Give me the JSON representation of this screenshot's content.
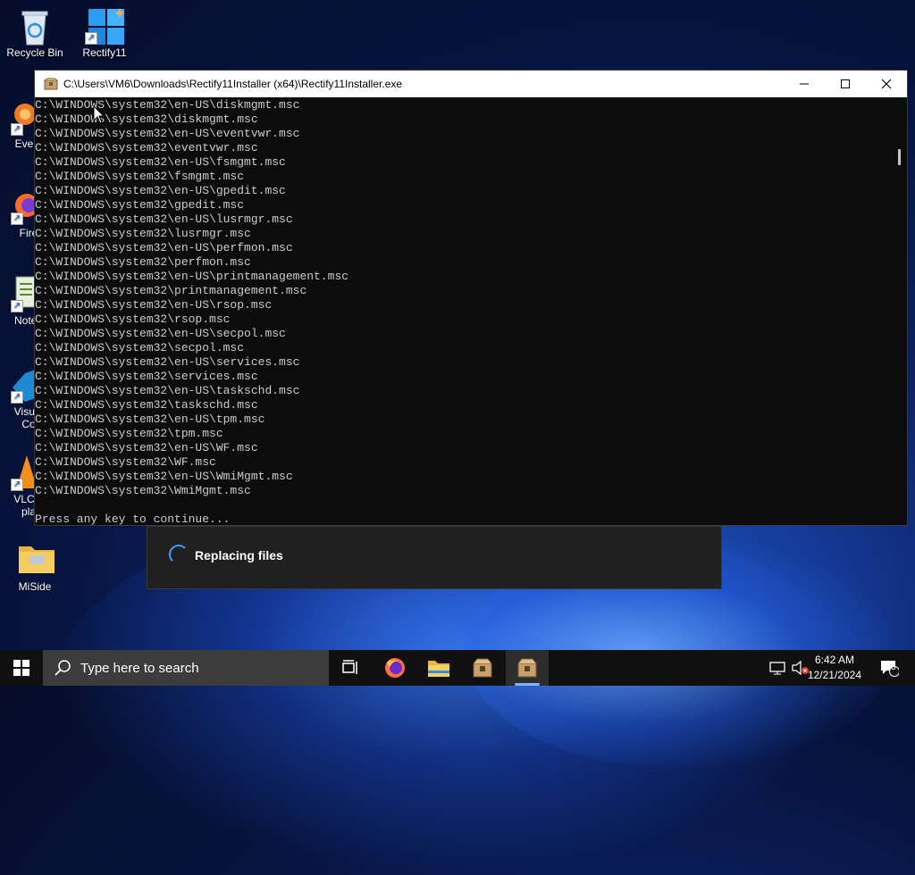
{
  "desktop": {
    "icons": [
      {
        "label": "Recycle Bin"
      },
      {
        "label": "Rectify11"
      },
      {
        "label": "Every"
      },
      {
        "label": "Fire"
      },
      {
        "label": "Notep"
      },
      {
        "label": "Visual"
      },
      {
        "label": "Co"
      },
      {
        "label": "VLC n"
      },
      {
        "label": "pla"
      },
      {
        "label": "MiSide"
      }
    ]
  },
  "console": {
    "title": "C:\\Users\\VM6\\Downloads\\Rectify11Installer (x64)\\Rectify11Installer.exe",
    "lines": [
      "C:\\WINDOWS\\system32\\en-US\\diskmgmt.msc",
      "C:\\WINDOWS\\system32\\diskmgmt.msc",
      "C:\\WINDOWS\\system32\\en-US\\eventvwr.msc",
      "C:\\WINDOWS\\system32\\eventvwr.msc",
      "C:\\WINDOWS\\system32\\en-US\\fsmgmt.msc",
      "C:\\WINDOWS\\system32\\fsmgmt.msc",
      "C:\\WINDOWS\\system32\\en-US\\gpedit.msc",
      "C:\\WINDOWS\\system32\\gpedit.msc",
      "C:\\WINDOWS\\system32\\en-US\\lusrmgr.msc",
      "C:\\WINDOWS\\system32\\lusrmgr.msc",
      "C:\\WINDOWS\\system32\\en-US\\perfmon.msc",
      "C:\\WINDOWS\\system32\\perfmon.msc",
      "C:\\WINDOWS\\system32\\en-US\\printmanagement.msc",
      "C:\\WINDOWS\\system32\\printmanagement.msc",
      "C:\\WINDOWS\\system32\\en-US\\rsop.msc",
      "C:\\WINDOWS\\system32\\rsop.msc",
      "C:\\WINDOWS\\system32\\en-US\\secpol.msc",
      "C:\\WINDOWS\\system32\\secpol.msc",
      "C:\\WINDOWS\\system32\\en-US\\services.msc",
      "C:\\WINDOWS\\system32\\services.msc",
      "C:\\WINDOWS\\system32\\en-US\\taskschd.msc",
      "C:\\WINDOWS\\system32\\taskschd.msc",
      "C:\\WINDOWS\\system32\\en-US\\tpm.msc",
      "C:\\WINDOWS\\system32\\tpm.msc",
      "C:\\WINDOWS\\system32\\en-US\\WF.msc",
      "C:\\WINDOWS\\system32\\WF.msc",
      "C:\\WINDOWS\\system32\\en-US\\WmiMgmt.msc",
      "C:\\WINDOWS\\system32\\WmiMgmt.msc",
      "",
      "Press any key to continue..."
    ]
  },
  "dialog": {
    "status": "Replacing files"
  },
  "taskbar": {
    "search_placeholder": "Type here to search",
    "time": "6:42 AM",
    "date": "12/21/2024",
    "notification_count": "3"
  }
}
